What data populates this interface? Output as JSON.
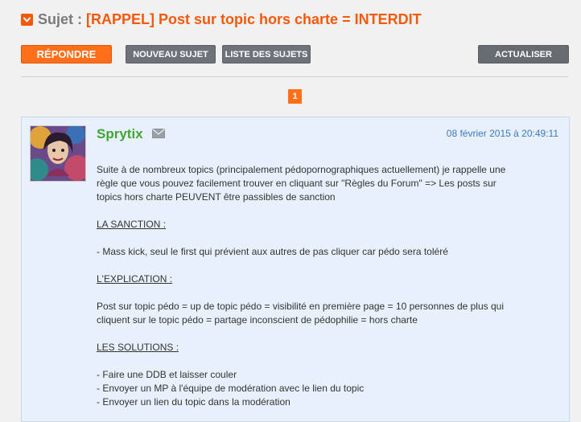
{
  "topic": {
    "prefix": "Sujet :",
    "title": "[RAPPEL] Post sur topic hors charte = INTERDIT"
  },
  "toolbar": {
    "reply": "RÉPONDRE",
    "new_topic": "NOUVEAU SUJET",
    "topic_list": "LISTE DES SUJETS",
    "refresh": "ACTUALISER"
  },
  "pagination": {
    "current": "1"
  },
  "post": {
    "author": "Sprytix",
    "date": "08 février 2015 à 20:49:11",
    "intro_1": "Suite à de nombreux topics (principalement pédopornographiques actuellement) je rappelle une",
    "intro_2": "règle que vous pouvez facilement trouver en cliquant sur \"Règles du Forum\" => Les posts sur",
    "intro_3": "topics hors charte PEUVENT être passibles de sanction",
    "sanction_heading": "LA SANCTION :",
    "sanction_text": "- Mass kick, seul le first qui prévient aux autres de pas cliquer car pédo sera toléré",
    "explanation_heading": "L'EXPLICATION :",
    "explanation_1": "Post sur topic pédo = up de topic pédo = visibilité en première page = 10 personnes de plus qui",
    "explanation_2": "cliquent sur le topic pédo = partage inconscient de pédophilie = hors charte",
    "solutions_heading": "LES SOLUTIONS :",
    "solution_1": "- Faire une DDB et laisser couler",
    "solution_2": "- Envoyer un MP à l'équipe de modération avec le lien du topic",
    "solution_3": "- Envoyer un lien du topic dans la modération"
  },
  "colors": {
    "accent": "#ff6e18",
    "title_orange": "#f4590b",
    "author_green": "#3fa535",
    "date_blue": "#3b78c2",
    "post_bg": "#e8f1fb",
    "grey_button": "#6d7378"
  },
  "icons": {
    "collapse": "chevron-down-icon",
    "mail": "envelope-icon"
  }
}
